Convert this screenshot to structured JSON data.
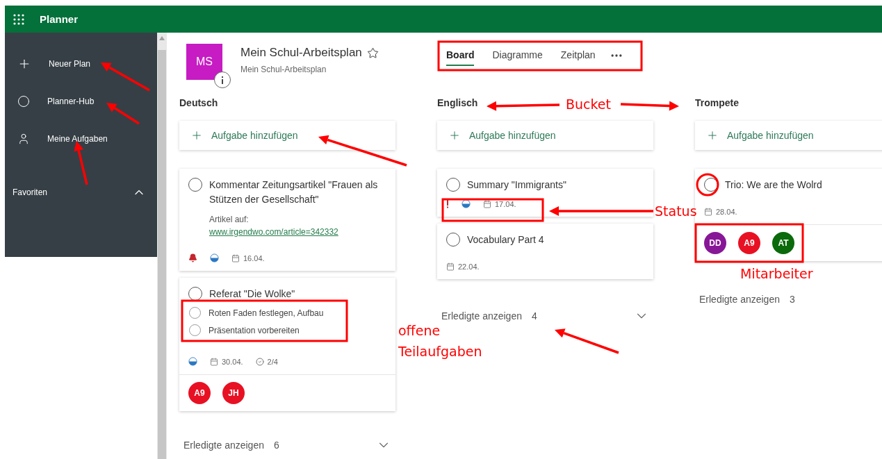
{
  "app": {
    "title": "Planner"
  },
  "sidebar": {
    "items": [
      {
        "label": "Neuer Plan"
      },
      {
        "label": "Planner-Hub"
      },
      {
        "label": "Meine Aufgaben"
      }
    ],
    "favorites": {
      "label": "Favoriten",
      "expanded": true
    }
  },
  "plan": {
    "initials": "MS",
    "title": "Mein Schul-Arbeitsplan",
    "subtitle": "Mein Schul-Arbeitsplan",
    "favorite": false
  },
  "tabs": [
    {
      "label": "Board",
      "selected": true
    },
    {
      "label": "Diagramme",
      "selected": false
    },
    {
      "label": "Zeitplan",
      "selected": false
    }
  ],
  "buckets": [
    {
      "name": "Deutsch",
      "add_label": "Aufgabe hinzufügen",
      "tasks": [
        {
          "title": "Kommentar Zeitungsartikel \"Frauen als Stützen der Gesellschaft\"",
          "completed": false,
          "note": "Artikel auf:",
          "link": "www.irgendwo.com/article=342332",
          "urgent": true,
          "in_progress": true,
          "due": "16.04."
        },
        {
          "title": "Referat \"Die Wolke\"",
          "completed": false,
          "checklist": [
            {
              "label": "Roten Faden festlegen, Aufbau",
              "checked": false
            },
            {
              "label": "Präsentation vorbereiten",
              "checked": false
            }
          ],
          "in_progress": true,
          "due": "30.04.",
          "checklist_count": "2/4",
          "assignees": [
            {
              "initials": "A9",
              "color": "#e81123"
            },
            {
              "initials": "JH",
              "color": "#e81123"
            }
          ]
        }
      ],
      "completed": {
        "label": "Erledigte anzeigen",
        "count": "6"
      }
    },
    {
      "name": "Englisch",
      "add_label": "Aufgabe hinzufügen",
      "tasks": [
        {
          "title": "Summary \"Immigrants\"",
          "completed": false,
          "important": true,
          "in_progress": true,
          "due": "17.04."
        },
        {
          "title": "Vocabulary Part 4",
          "completed": false,
          "due": "22.04."
        }
      ],
      "completed": {
        "label": "Erledigte anzeigen",
        "count": "4"
      }
    },
    {
      "name": "Trompete",
      "add_label": "Aufgabe hinzufügen",
      "tasks": [
        {
          "title": "Trio: We are the Wolrd",
          "completed": false,
          "due": "28.04.",
          "assignees": [
            {
              "initials": "DD",
              "color": "#881798"
            },
            {
              "initials": "A9",
              "color": "#e81123"
            },
            {
              "initials": "AT",
              "color": "#0b6a0b"
            }
          ]
        }
      ],
      "completed": {
        "label": "Erledigte anzeigen",
        "count": "3"
      }
    }
  ],
  "annotations": [
    {
      "text": "Bucket"
    },
    {
      "text": "Status"
    },
    {
      "text": "Mitarbeiter"
    },
    {
      "text": "offene Teilaufgaben"
    }
  ]
}
